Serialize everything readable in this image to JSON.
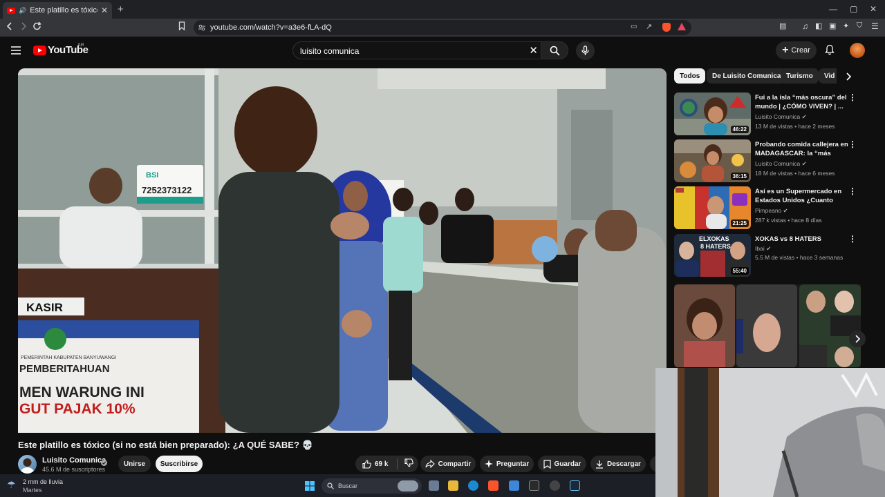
{
  "browser": {
    "tab_title": "Este platillo es tóxico (si no es",
    "url": "youtube.com/watch?v=a3e6-fLA-dQ"
  },
  "masthead": {
    "logo_text": "YouTube",
    "logo_region": "AR",
    "search_value": "luisito comunica",
    "create_label": "Crear"
  },
  "video": {
    "title": "Este platillo es tóxico (si no está bien preparado): ¿A QUÉ SABE? 💀",
    "overlay_texts": {
      "bsi_brand": "BSI",
      "bsi_number": "7252373122",
      "kasir": "KASIR",
      "notice_1": "PEMERINTAH KABUPATEN BANYUWANGI",
      "notice_2": "PEMBERITAHUAN",
      "notice_3": "MEN WARUNG INI",
      "notice_4": "GUT PAJAK 10%"
    }
  },
  "channel": {
    "name": "Luisito Comunica",
    "subscribers": "45.6 M de suscriptores",
    "join_label": "Unirse",
    "subscribe_label": "Suscribirse"
  },
  "actions": {
    "likes": "69 k",
    "share": "Compartir",
    "ask": "Preguntar",
    "save": "Guardar",
    "download": "Descargar"
  },
  "chips": [
    "Todos",
    "De Luisito Comunica",
    "Turismo",
    "Vid"
  ],
  "recommendations": [
    {
      "title": "Fui a la isla “más oscura” del mundo | ¿CÓMO VIVEN? | ...",
      "channel": "Luisito Comunica",
      "meta": "13 M de vistas • hace 2 meses",
      "duration": "46:22",
      "verified": true
    },
    {
      "title": "Probando comida callejera en MADAGASCAR: la “más barata...",
      "channel": "Luisito Comunica",
      "meta": "18 M de vistas • hace 6 meses",
      "duration": "36:15",
      "verified": true
    },
    {
      "title": "Así es un Supermercado en Estados Unidos ¿Cuanto Gast...",
      "channel": "Pimpeano",
      "meta": "287 k vistas • hace 8 días",
      "duration": "21:25",
      "verified": true
    },
    {
      "title": "XOKAS vs 8 HATERS",
      "channel": "Ibai",
      "meta": "5.5 M de vistas • hace 3 semanas",
      "duration": "55:40",
      "verified": true
    }
  ],
  "thumb_captions": {
    "xokas_1": "ELXOKAS",
    "xokas_2": "8 HATERS"
  },
  "taskbar": {
    "weather": "2 mm de lluvia",
    "day": "Martes",
    "search_placeholder": "Buscar"
  },
  "colors": {
    "background": "#0f0f0f",
    "brand_red": "#ff0000",
    "chip_active": "#f1f1f1",
    "secondary_text": "#aaaaaa"
  },
  "icons": [
    "menu-icon",
    "search-icon",
    "mic-icon",
    "bell-icon",
    "like-icon",
    "dislike-icon",
    "share-icon",
    "ask-icon",
    "save-icon",
    "download-icon",
    "chevron-right-icon",
    "more-vert-icon",
    "verified-icon"
  ]
}
